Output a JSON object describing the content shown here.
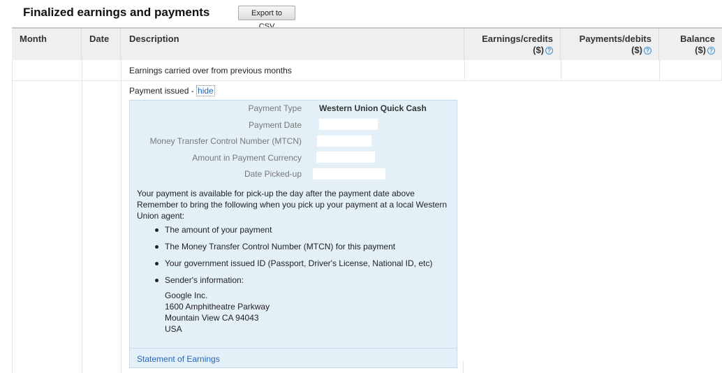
{
  "page": {
    "title": "Finalized earnings and payments",
    "export_label": "Export to CSV"
  },
  "table": {
    "columns": {
      "month": "Month",
      "date": "Date",
      "description": "Description",
      "earnings_line1": "Earnings/credits",
      "earnings_line2": "($)",
      "payments_line1": "Payments/debits",
      "payments_line2": "($)",
      "balance_line1": "Balance",
      "balance_line2": "($)"
    },
    "help_icon_glyph": "?",
    "rows": {
      "carried_over": "Earnings carried over from previous months",
      "payment_issued": "Payment issued - ",
      "hide_link": "hide"
    }
  },
  "payment_details": {
    "fields": [
      {
        "label": "Payment Type",
        "value": "Western Union Quick Cash",
        "redacted": false
      },
      {
        "label": "Payment Date",
        "value": "",
        "redacted": true
      },
      {
        "label": "Money Transfer Control Number (MTCN)",
        "value": "",
        "redacted": true
      },
      {
        "label": "Amount in Payment Currency",
        "value": "",
        "redacted": true
      },
      {
        "label": "Date Picked-up",
        "value": "",
        "redacted": true
      }
    ],
    "info_line1": "Your payment is available for pick-up the day after the payment date above",
    "info_line2": "Remember to bring the following when you pick up your payment at a local Western Union agent:",
    "bullets": [
      "The amount of your payment",
      "The Money Transfer Control Number (MTCN) for this payment",
      "Your government issued ID (Passport, Driver's License, National ID, etc)",
      "Sender's information:"
    ],
    "sender_address": [
      "Google Inc.",
      "1600 Amphitheatre Parkway",
      "Mountain View CA 94043",
      "USA"
    ],
    "footer_link": "Statement of Earnings"
  },
  "colors": {
    "link": "#2266bb",
    "detail_background": "#e4f0f8",
    "header_background": "#efefef"
  }
}
